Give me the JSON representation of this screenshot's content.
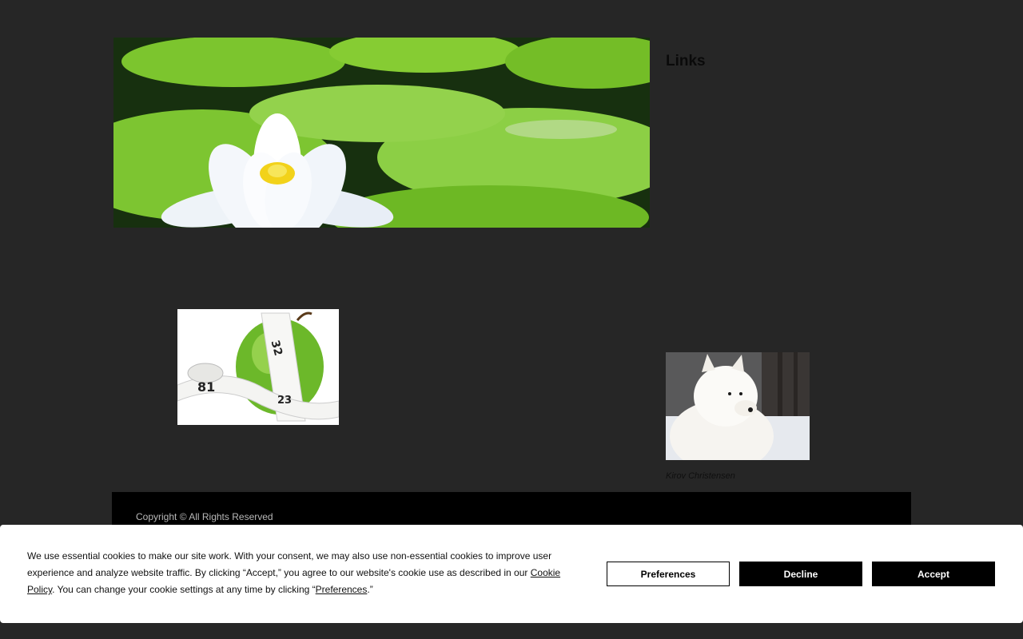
{
  "sidebar": {
    "links_heading": "Links",
    "dog_caption": "Kirov Christensen"
  },
  "footer": {
    "copyright": "Copyright  © All Rights Reserved"
  },
  "cookie_banner": {
    "text_part1": "We use essential cookies to make our site work. With your consent, we may also use non-essential cookies to improve user experience and analyze website traffic. By clicking “Accept,” you agree to our website's cookie use as described in our ",
    "cookie_policy_link": "Cookie Policy",
    "text_part2": ". You can change your cookie settings at any time by clicking “",
    "preferences_link": "Preferences",
    "text_part3": ".”",
    "buttons": {
      "preferences": "Preferences",
      "decline": "Decline",
      "accept": "Accept"
    }
  },
  "images": {
    "hero": "water-lily-lily-pads-photo",
    "apple": "green-apple-measuring-tape-photo",
    "dog": "white-samoyed-dog-photo"
  },
  "colors": {
    "page_background": "#262626",
    "footer_background": "#000000",
    "banner_background": "#ffffff",
    "button_dark": "#000000"
  }
}
